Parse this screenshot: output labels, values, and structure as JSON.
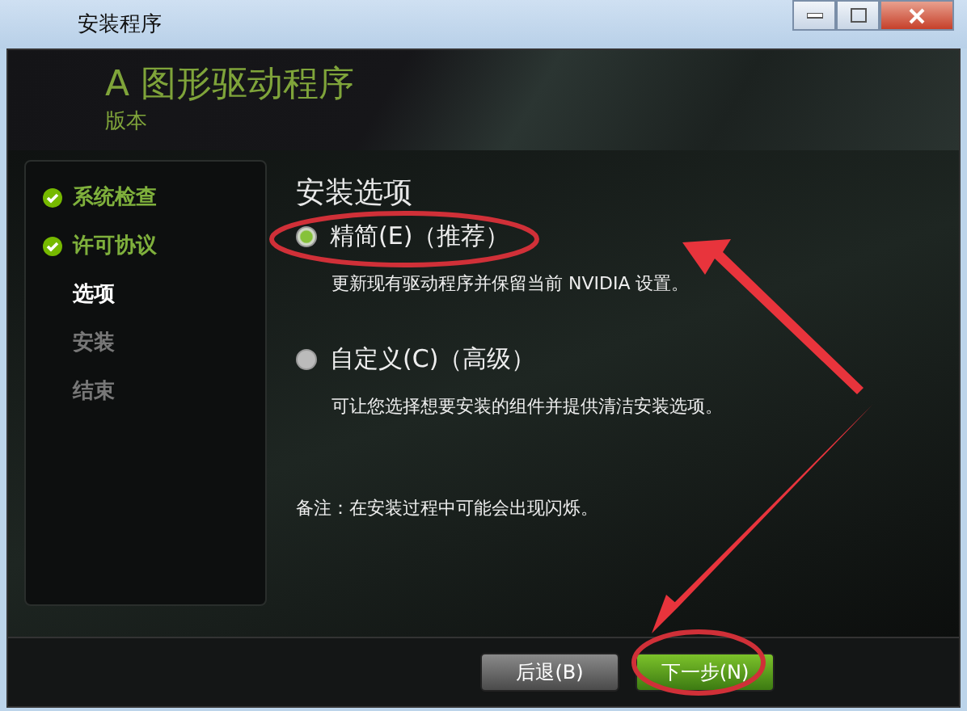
{
  "window": {
    "title": "安装程序"
  },
  "header": {
    "title": "A 图形驱动程序",
    "version_label": "版本"
  },
  "steps": [
    {
      "label": "系统检查",
      "done": true,
      "selected": false
    },
    {
      "label": "许可协议",
      "done": true,
      "selected": false
    },
    {
      "label": "选项",
      "done": false,
      "selected": true
    },
    {
      "label": "安装",
      "done": false,
      "selected": false
    },
    {
      "label": "结束",
      "done": false,
      "selected": false
    }
  ],
  "content": {
    "heading": "安装选项",
    "options": [
      {
        "label": "精简(E)（推荐）",
        "description": "更新现有驱动程序并保留当前 NVIDIA 设置。",
        "selected": true
      },
      {
        "label": "自定义(C)（高级）",
        "description": "可让您选择想要安装的组件并提供清洁安装选项。",
        "selected": false
      }
    ],
    "note": "备注：在安装过程中可能会出现闪烁。"
  },
  "buttons": [
    {
      "label": "后退(B)",
      "kind": "secondary"
    },
    {
      "label": "下一步(N)",
      "kind": "primary"
    }
  ]
}
